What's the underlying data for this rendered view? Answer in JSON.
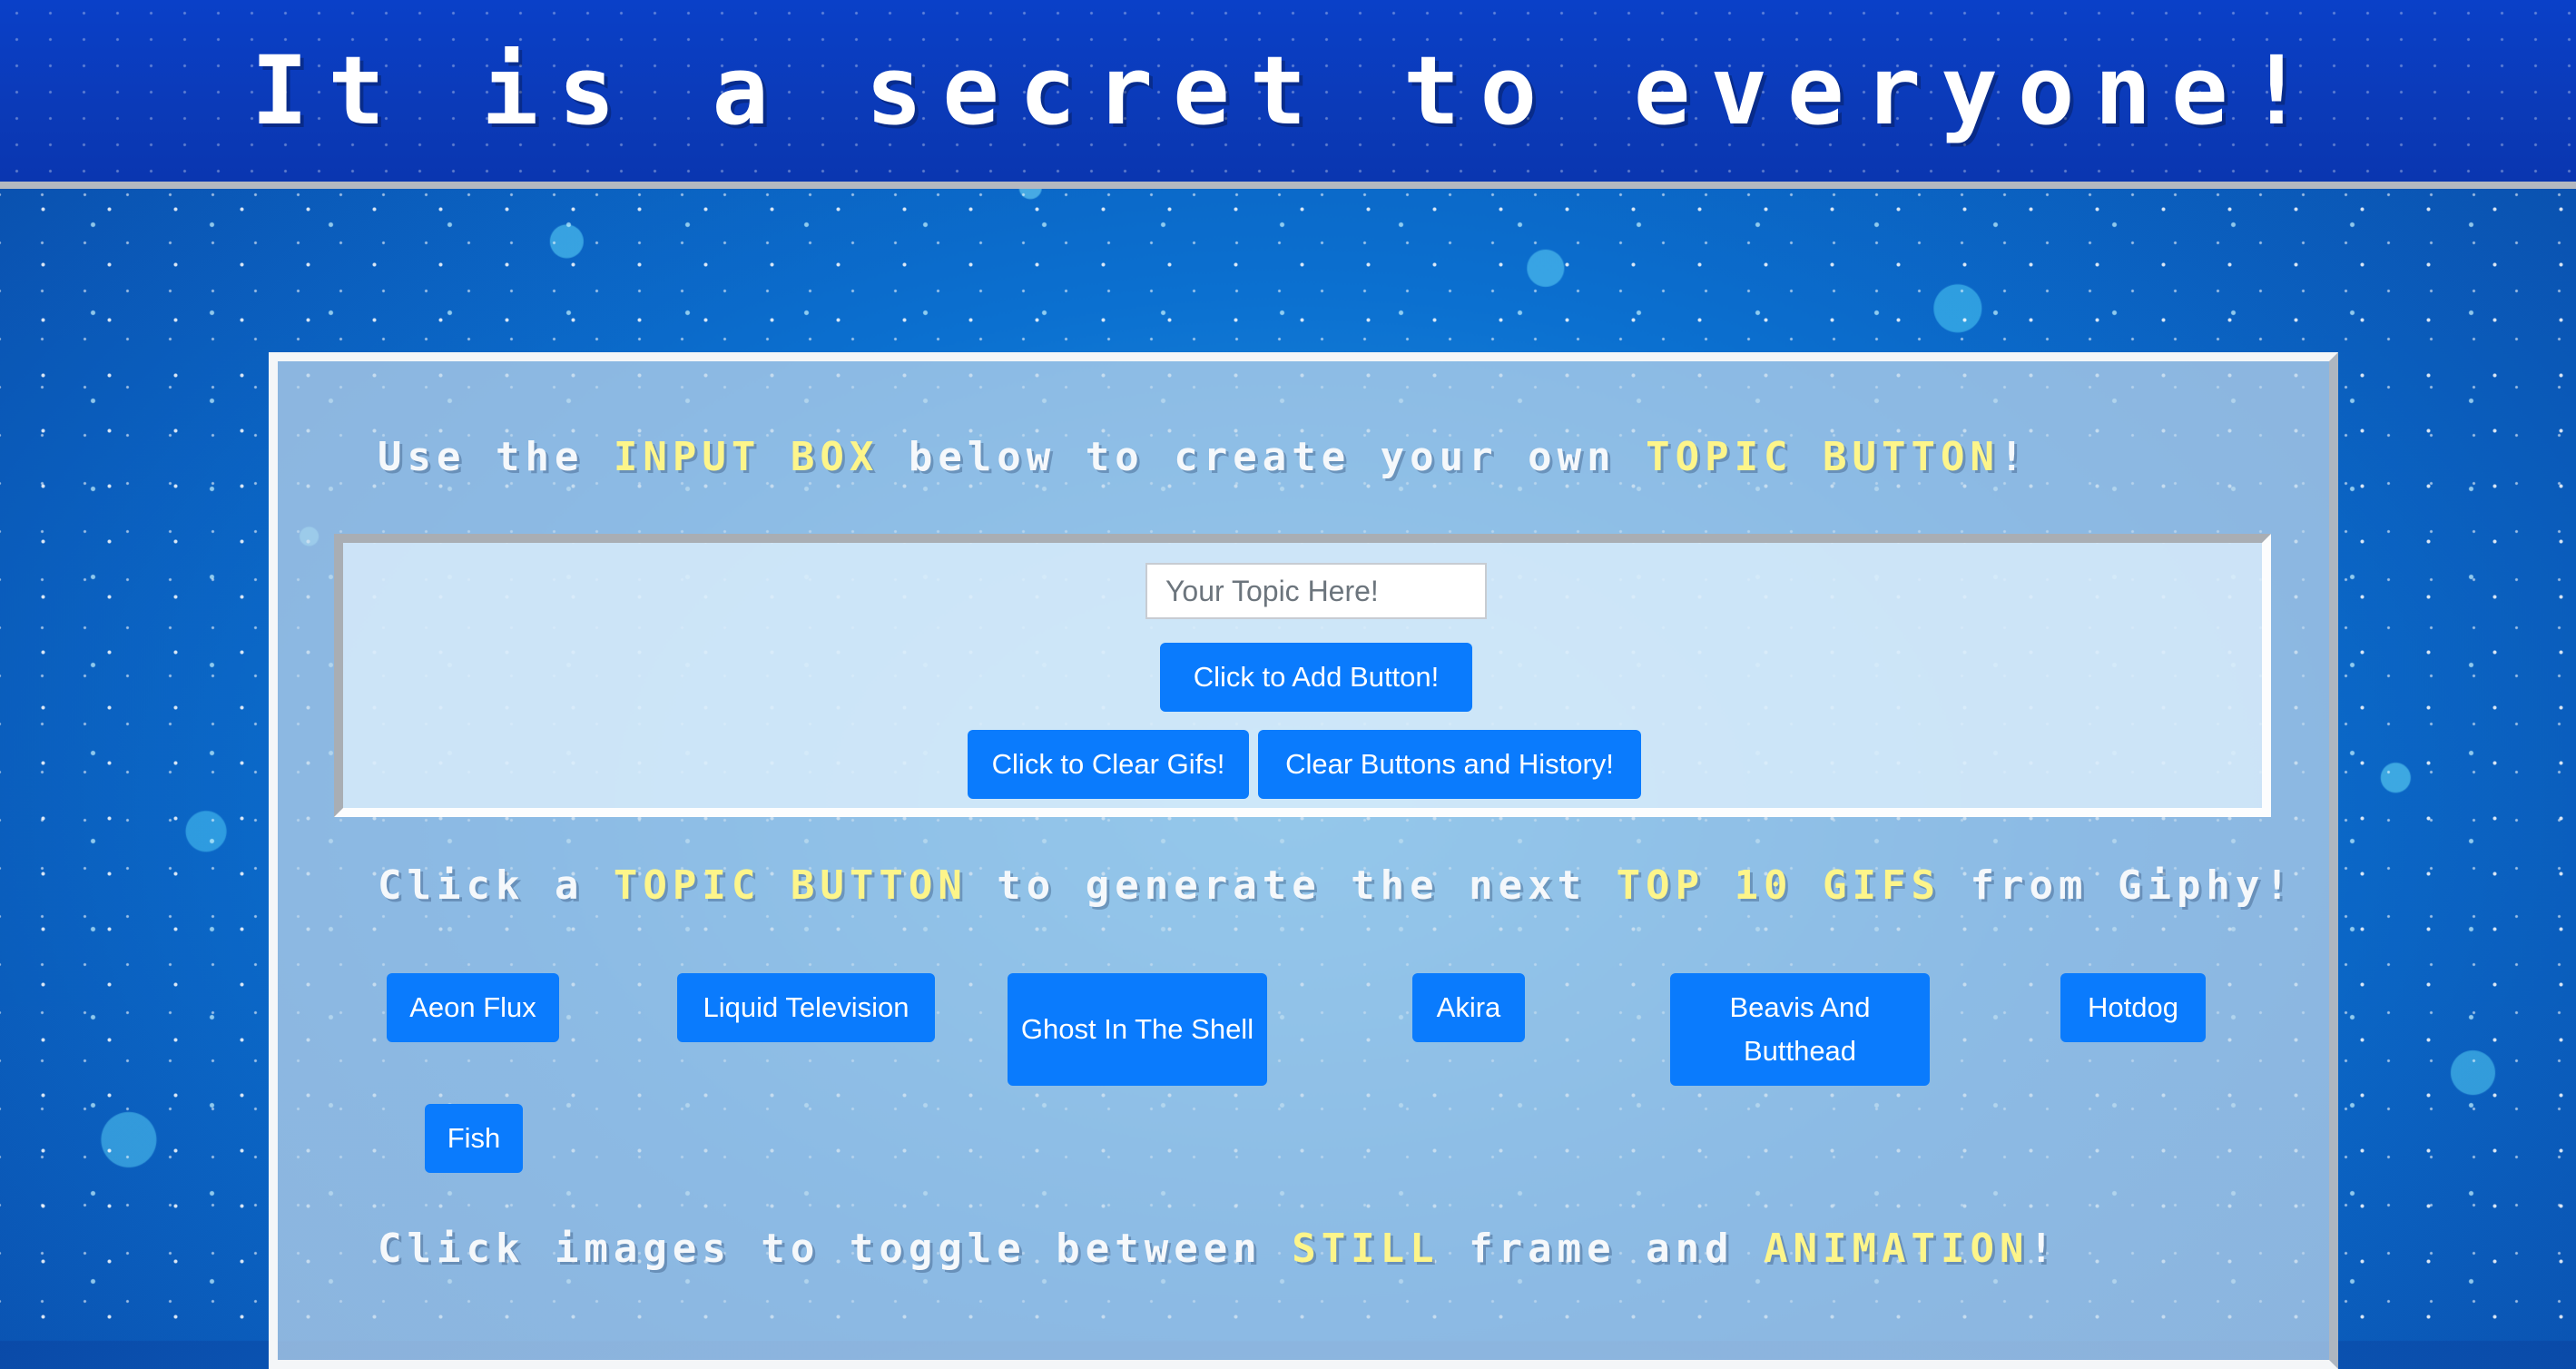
{
  "header": {
    "title": "It is a secret to everyone!"
  },
  "instructions": {
    "line1": {
      "pre": "Use the ",
      "hl1": "INPUT BOX",
      "mid": " below to create your own ",
      "hl2": "TOPIC BUTTON",
      "post": "!"
    },
    "line2": {
      "pre": "Click a ",
      "hl1": "TOPIC BUTTON",
      "mid": " to generate the next ",
      "hl2": "TOP 10 GIFS",
      "post": " from Giphy!"
    },
    "line3": {
      "pre": "Click images to toggle between ",
      "hl1": "STILL",
      "mid": " frame and ",
      "hl2": "ANIMATION",
      "post": "!"
    }
  },
  "form": {
    "topic_placeholder": "Your Topic Here!",
    "topic_value": "",
    "add_button_label": "Click to Add Button!",
    "clear_gifs_label": "Click to Clear Gifs!",
    "clear_all_label": "Clear Buttons and History!"
  },
  "topics": [
    "Aeon Flux",
    "Liquid Television",
    "Ghost In The Shell",
    "Akira",
    "Beavis And Butthead",
    "Hotdog",
    "Fish"
  ],
  "colors": {
    "button": "#0a7bfd",
    "highlight": "#fdf58a",
    "banner": "#0a3cbc"
  }
}
